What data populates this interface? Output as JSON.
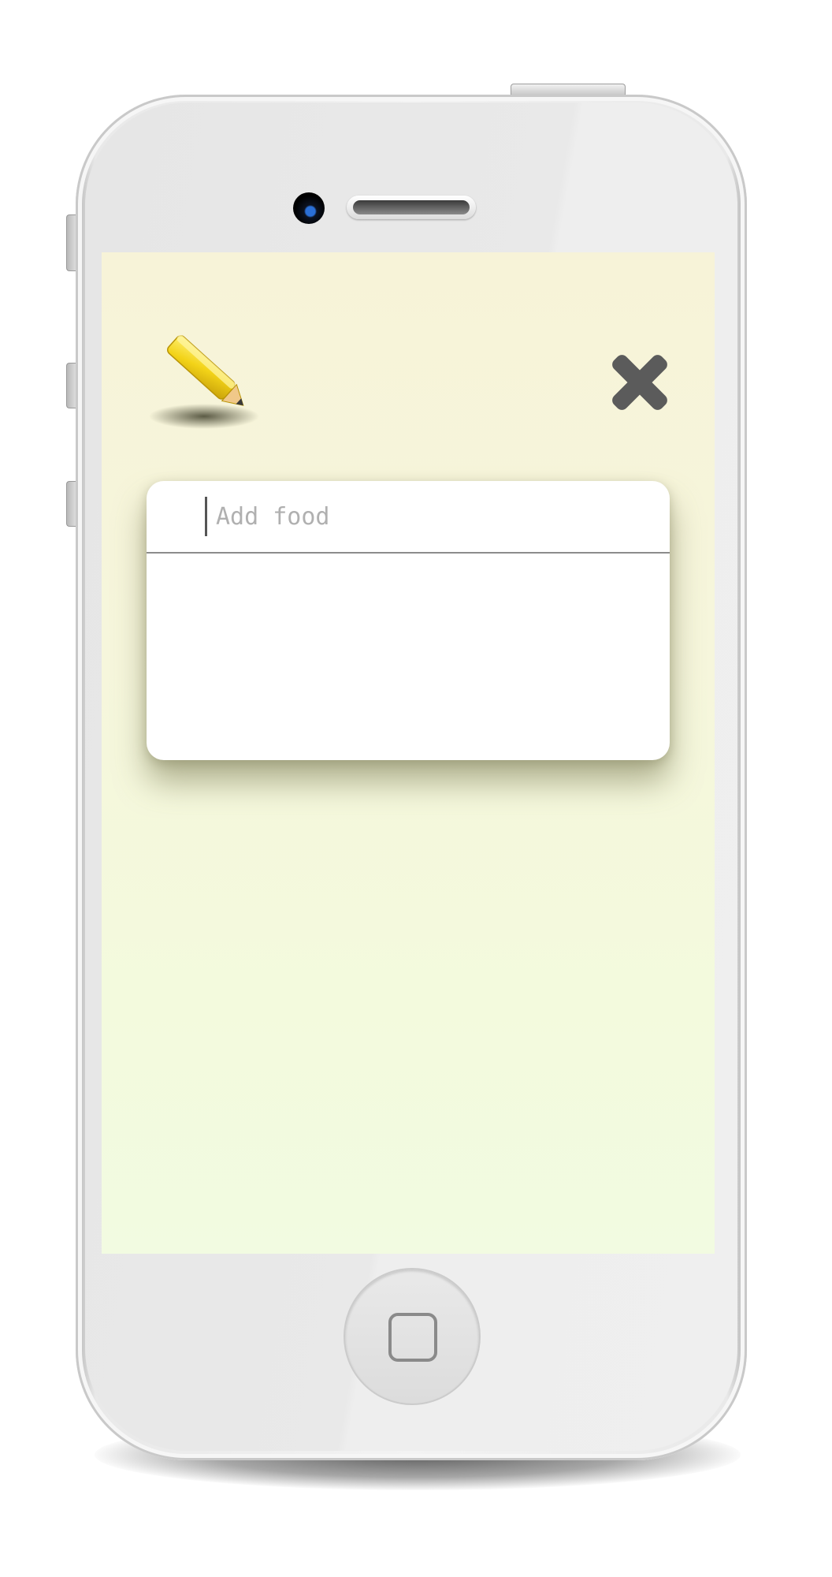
{
  "screen": {
    "header": {
      "edit_icon": "pencil-icon",
      "close_icon": "close-icon"
    },
    "food_entry": {
      "input_value": "",
      "input_placeholder": "Add food"
    },
    "food_list": {
      "items": []
    }
  },
  "device": {
    "home_button_icon": "home-square-icon"
  },
  "colors": {
    "background": "#f6f6dc",
    "close_icon": "#5b5b5b",
    "pencil": "#f2cf1a",
    "card": "#ffffff"
  }
}
